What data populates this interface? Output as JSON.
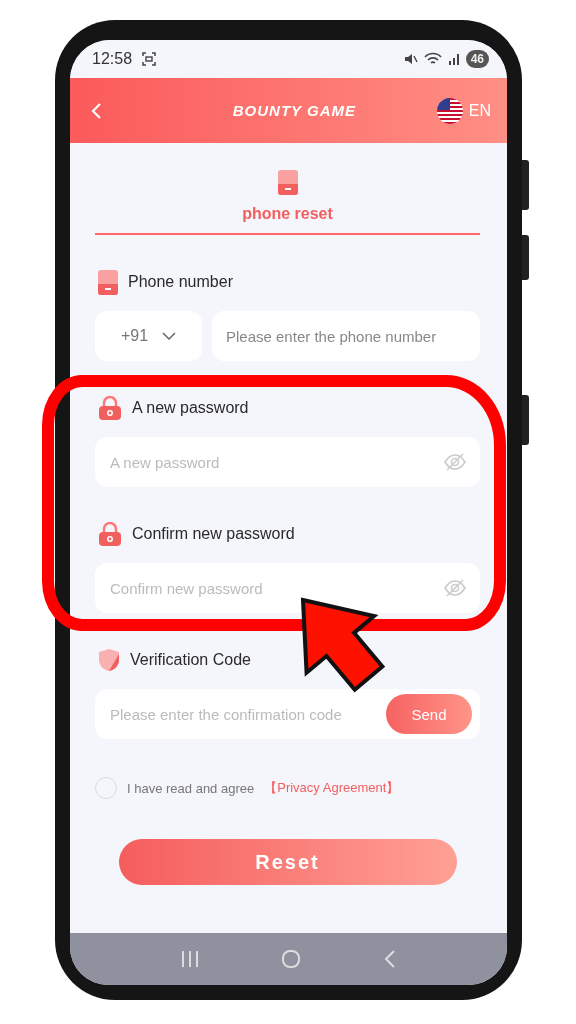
{
  "status_bar": {
    "time": "12:58",
    "battery": "46"
  },
  "header": {
    "title": "BOUNTY GAME",
    "language": "EN"
  },
  "tab": {
    "label": "phone reset",
    "selected": true
  },
  "fields": [
    {
      "kind": "phone",
      "label": "Phone number",
      "country_code": "+91",
      "placeholder": "Please enter the phone number"
    },
    {
      "kind": "password",
      "label": "A new password",
      "placeholder": "A new password"
    },
    {
      "kind": "password",
      "label": "Confirm new password",
      "placeholder": "Confirm new password"
    },
    {
      "kind": "code",
      "label": "Verification Code",
      "placeholder": "Please enter the confirmation code",
      "button": "Send"
    }
  ],
  "agreement": {
    "checked": false,
    "text": "I have read and agree",
    "link": "【Privacy Agreement】"
  },
  "reset_button": "Reset"
}
